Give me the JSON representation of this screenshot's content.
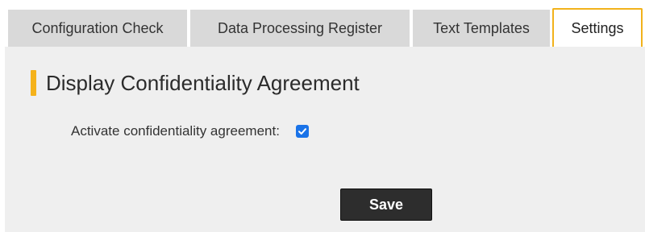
{
  "tabs": [
    {
      "label": "Configuration Check",
      "active": false
    },
    {
      "label": "Data Processing Register",
      "active": false
    },
    {
      "label": "Text Templates",
      "active": false
    },
    {
      "label": "Settings",
      "active": true
    }
  ],
  "section": {
    "title": "Display Confidentiality Agreement"
  },
  "fields": {
    "confidentiality": {
      "label": "Activate confidentiality agreement:",
      "checked": true
    }
  },
  "actions": {
    "save_label": "Save"
  },
  "colors": {
    "accent": "#f5b21a",
    "active_tab_border": "#f2b21b",
    "checkbox": "#1a73e8",
    "button_bg": "#2d2d2d"
  }
}
